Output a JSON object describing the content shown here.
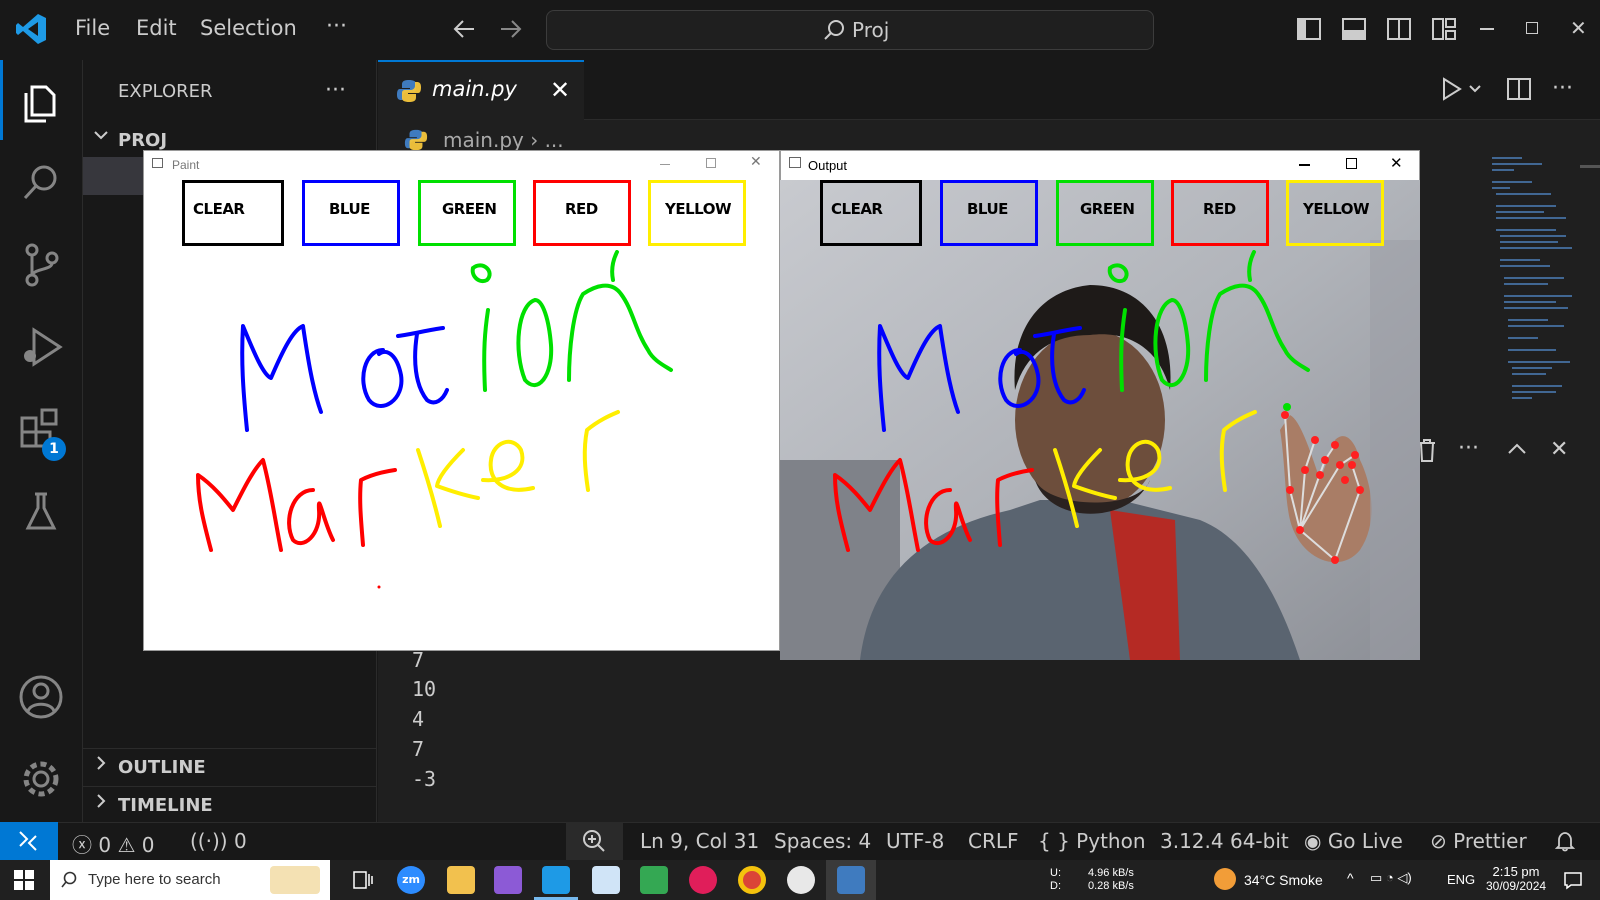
{
  "menu": [
    "File",
    "Edit",
    "Selection"
  ],
  "search_text": "Proj",
  "explorer": {
    "title": "EXPLORER",
    "project": "PROJ",
    "outline": "OUTLINE",
    "timeline": "TIMELINE",
    "extensions_badge": "1"
  },
  "tab": {
    "label": "main.py"
  },
  "breadcrumb": {
    "file": "main.py",
    "more": "..."
  },
  "output_lines": [
    "7",
    "10",
    "4",
    "7",
    "-3"
  ],
  "paint_window": {
    "title": "Paint",
    "buttons": [
      "CLEAR",
      "BLUE",
      "GREEN",
      "RED",
      "YELLOW"
    ]
  },
  "output_window": {
    "title": "Output",
    "buttons": [
      "CLEAR",
      "BLUE",
      "GREEN",
      "RED",
      "YELLOW"
    ]
  },
  "status": {
    "errors": "0",
    "warnings": "0",
    "ports": "0",
    "position": "Ln 9, Col 31",
    "spaces": "Spaces: 4",
    "encoding": "UTF-8",
    "eol": "CRLF",
    "language_braces": "{ }",
    "language": "Python",
    "interpreter": "3.12.4 64-bit",
    "go_live": "Go Live",
    "prettier": "Prettier"
  },
  "taskbar": {
    "search_placeholder": "Type here to search",
    "net_up_label": "U:",
    "net_down_label": "D:",
    "net_up": "4.96 kB/s",
    "net_down": "0.28 kB/s",
    "weather": "34°C  Smoke",
    "lang": "ENG",
    "time": "2:15 pm",
    "date": "30/09/2024"
  },
  "colors": {
    "accent": "#0078d4",
    "blue": "#0000ff",
    "green": "#00e000",
    "red": "#ff0000",
    "yellow": "#ffee00"
  }
}
